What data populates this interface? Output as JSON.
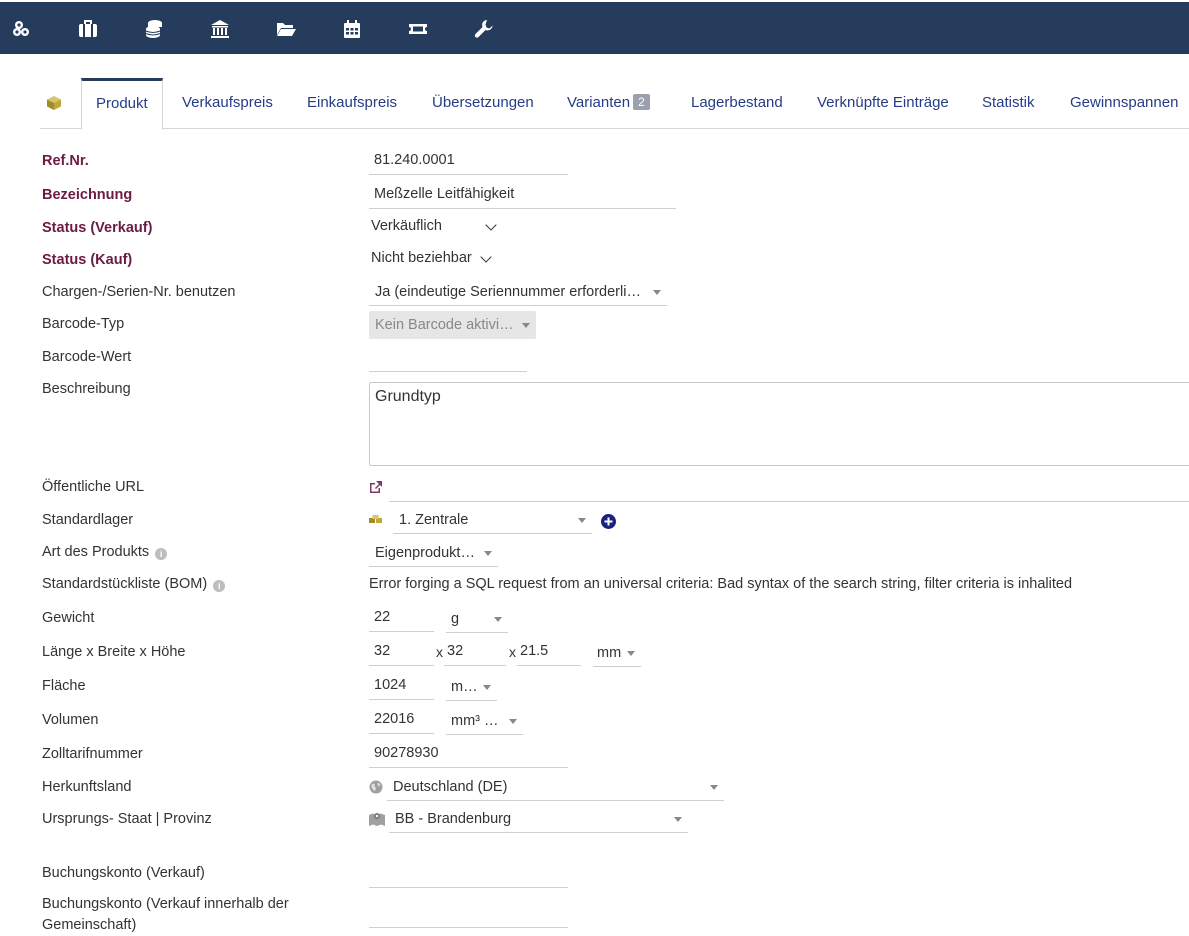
{
  "toolbar": {
    "icons": [
      "boxes-icon",
      "briefcase-icon",
      "coins-icon",
      "bank-icon",
      "folder-icon",
      "calendar-icon",
      "ticket-icon",
      "wrench-icon"
    ]
  },
  "tabs": [
    {
      "label": "Produkt",
      "active": true
    },
    {
      "label": "Verkaufspreis"
    },
    {
      "label": "Einkaufspreis"
    },
    {
      "label": "Übersetzungen"
    },
    {
      "label": "Varianten",
      "badge": "2"
    },
    {
      "label": "Lagerbestand"
    },
    {
      "label": "Verknüpfte Einträge"
    },
    {
      "label": "Statistik"
    },
    {
      "label": "Gewinnspannen"
    }
  ],
  "form": {
    "ref_label": "Ref.Nr.",
    "ref_value": "81.240.0001",
    "name_label": "Bezeichnung",
    "name_value": "Meßzelle Leitfähigkeit",
    "status_sell_label": "Status (Verkauf)",
    "status_sell_value": "Verkäuflich",
    "status_buy_label": "Status (Kauf)",
    "status_buy_value": "Nicht beziehbar",
    "batch_label": "Chargen-/Serien-Nr. benutzen",
    "batch_value": "Ja (eindeutige Seriennummer erforderli…",
    "barcode_type_label": "Barcode-Typ",
    "barcode_type_value": "Kein Barcode aktivi…",
    "barcode_value_label": "Barcode-Wert",
    "barcode_value": "",
    "description_label": "Beschreibung",
    "description_value": "Grundtyp",
    "public_url_label": "Öffentliche URL",
    "warehouse_label": "Standardlager",
    "warehouse_value": "1. Zentrale",
    "product_type_label": "Art des Produkts",
    "product_type_value": "Eigenprodukt…",
    "bom_label": "Standardstückliste (BOM)",
    "bom_error": "Error forging a SQL request from an universal criteria: Bad syntax of the search string, filter criteria is inhalited",
    "weight_label": "Gewicht",
    "weight_value": "22",
    "weight_unit": "g",
    "dims_label": "Länge x Breite x Höhe",
    "dims_length": "32",
    "dims_width": "32",
    "dims_height": "21.5",
    "dims_x": "x",
    "dims_unit": "mm",
    "area_label": "Fläche",
    "area_value": "1024",
    "area_unit": "m…",
    "volume_label": "Volumen",
    "volume_value": "22016",
    "volume_unit": "mm³ …",
    "customs_label": "Zolltarifnummer",
    "customs_value": "90278930",
    "country_label": "Herkunftsland",
    "country_value": "Deutschland (DE)",
    "state_label": "Ursprungs- Staat | Provinz",
    "state_value": "BB - Brandenburg",
    "account_sell_label": "Buchungskonto (Verkauf)",
    "account_sell_intra_label_1": "Buchungskonto (Verkauf innerhalb der",
    "account_sell_intra_label_2": "Gemeinschaft)"
  },
  "colors": {
    "topbar": "#263c5c",
    "tab_text": "#263c85",
    "required_label": "#6b1b44",
    "plus_icon": "#1a237e"
  }
}
